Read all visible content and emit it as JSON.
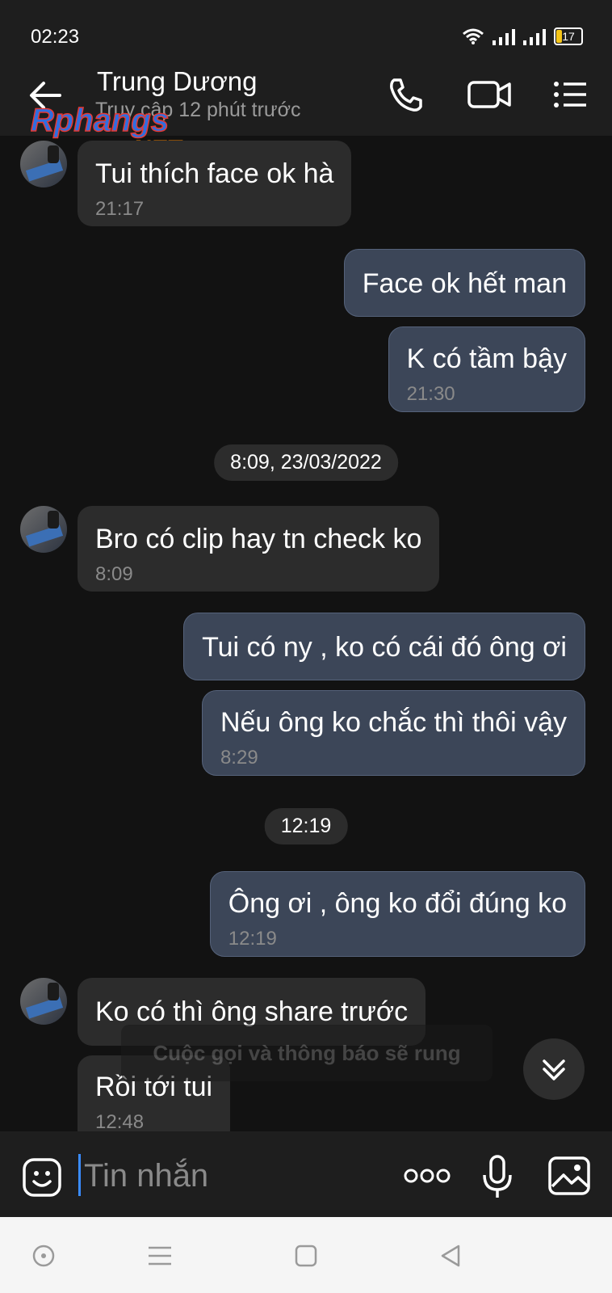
{
  "status_bar": {
    "time": "02:23",
    "battery": "17"
  },
  "header": {
    "contact_name": "Trung Dương",
    "contact_status": "Truy cập 12 phút trước",
    "watermark_text": "Rphangs.NET"
  },
  "messages": [
    {
      "direction": "in",
      "text": "Tui thích face ok hà",
      "time": "21:17"
    },
    {
      "direction": "out",
      "text": "Face ok hết man",
      "time": ""
    },
    {
      "direction": "out",
      "text": "K có tầm bậy",
      "time": "21:30"
    },
    {
      "direction": "in",
      "text": "Bro có clip hay tn check ko",
      "time": "8:09"
    },
    {
      "direction": "out",
      "text": "Tui có ny , ko có cái đó ông ơi",
      "time": ""
    },
    {
      "direction": "out",
      "text": "Nếu ông ko chắc thì thôi vậy",
      "time": "8:29"
    },
    {
      "direction": "out",
      "text": "Ông ơi , ông ko đổi đúng ko",
      "time": "12:19"
    },
    {
      "direction": "in",
      "text": "Ko có thì ông share trước",
      "time": ""
    },
    {
      "direction": "in",
      "text": "Rồi tới tui",
      "time": "12:48"
    }
  ],
  "date_separators": [
    "8:09, 23/03/2022",
    "12:19"
  ],
  "toast": "Cuộc gọi và thông báo sẽ rung",
  "input": {
    "placeholder": "Tin nhắn"
  },
  "colors": {
    "background": "#121212",
    "bar": "#1e1e1e",
    "incoming_bubble": "#2c2c2c",
    "outgoing_bubble": "#3c4658",
    "caret": "#3a8cff"
  }
}
